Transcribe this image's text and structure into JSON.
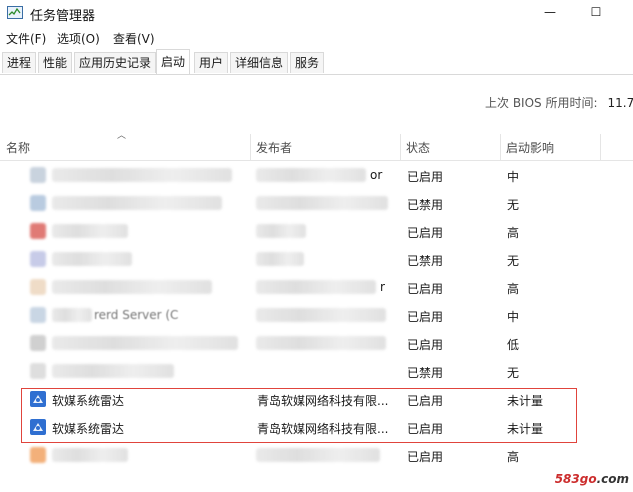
{
  "window": {
    "title": "任务管理器",
    "minimize": "—",
    "maximize": "☐"
  },
  "menu": [
    "文件(F)",
    "选项(O)",
    "查看(V)"
  ],
  "tabs": [
    "进程",
    "性能",
    "应用历史记录",
    "启动",
    "用户",
    "详细信息",
    "服务"
  ],
  "active_tab": "启动",
  "bios": {
    "label": "上次 BIOS 所用时间:",
    "value": "11.7"
  },
  "columns": {
    "name": "名称",
    "publisher": "发布者",
    "status": "状态",
    "impact": "启动影响"
  },
  "rows": [
    {
      "name": "",
      "publisher": "or",
      "status": "已启用",
      "impact": "中"
    },
    {
      "name": "",
      "publisher": "",
      "status": "已禁用",
      "impact": "无"
    },
    {
      "name": "",
      "publisher": "",
      "status": "已启用",
      "impact": "高"
    },
    {
      "name": "",
      "publisher": "",
      "status": "已禁用",
      "impact": "无"
    },
    {
      "name": "",
      "publisher": "r",
      "status": "已启用",
      "impact": "高"
    },
    {
      "name": "rerd Server (C",
      "publisher": "",
      "status": "已启用",
      "impact": "中"
    },
    {
      "name": "",
      "publisher": "",
      "status": "已启用",
      "impact": "低"
    },
    {
      "name": "",
      "publisher": "",
      "status": "已禁用",
      "impact": "无"
    },
    {
      "name": "软媒系统雷达",
      "publisher": "青岛软媒网络科技有限...",
      "status": "已启用",
      "impact": "未计量"
    },
    {
      "name": "软媒系统雷达",
      "publisher": "青岛软媒网络科技有限...",
      "status": "已启用",
      "impact": "未计量"
    },
    {
      "name": "",
      "publisher": "",
      "status": "已启用",
      "impact": "高"
    }
  ],
  "watermark": {
    "brand": "583go",
    "tld": ".com"
  }
}
